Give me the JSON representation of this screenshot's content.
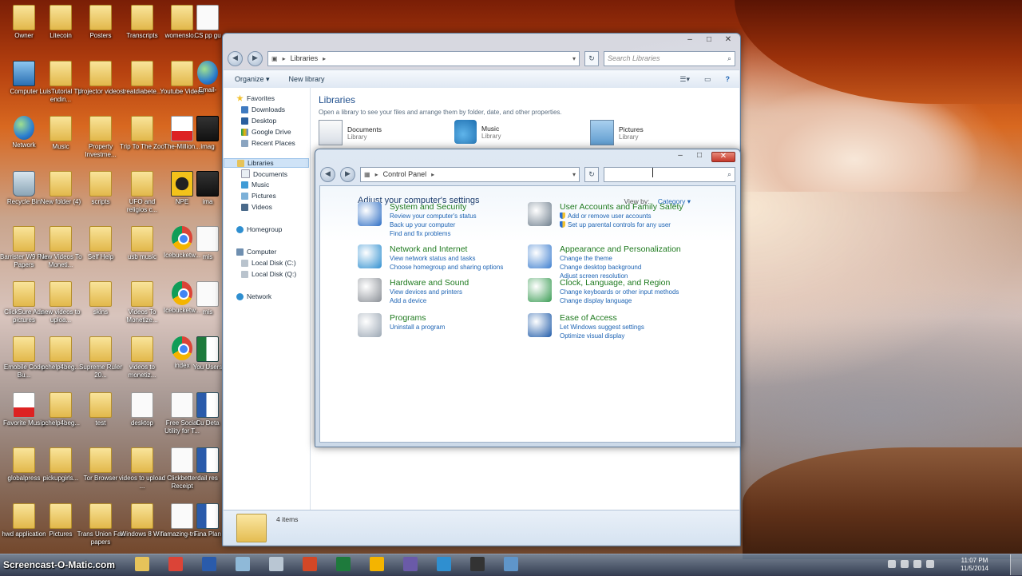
{
  "desktop": {
    "icons": [
      {
        "label": "Owner",
        "type": "folder"
      },
      {
        "label": "Litecoin",
        "type": "folder"
      },
      {
        "label": "Posters",
        "type": "folder"
      },
      {
        "label": "Transcripts",
        "type": "folder"
      },
      {
        "label": "womenslo...",
        "type": "folder"
      },
      {
        "label": "CS pp gu",
        "type": "doc"
      },
      {
        "label": "Computer",
        "type": "pc"
      },
      {
        "label": "LuisTutorial TV endin...",
        "type": "folder"
      },
      {
        "label": "projector videos",
        "type": "folder"
      },
      {
        "label": "treatdiabete...",
        "type": "folder"
      },
      {
        "label": "Youtube Videos",
        "type": "folder"
      },
      {
        "label": "Email-",
        "type": "globe"
      },
      {
        "label": "Network",
        "type": "globe"
      },
      {
        "label": "Music",
        "type": "folder"
      },
      {
        "label": "Property Investme...",
        "type": "folder"
      },
      {
        "label": "Trip To The Zoo",
        "type": "folder"
      },
      {
        "label": "The-Million...",
        "type": "pdf"
      },
      {
        "label": "imag",
        "type": "dark"
      },
      {
        "label": "Recycle Bin",
        "type": "bin"
      },
      {
        "label": "New folder (4)",
        "type": "folder"
      },
      {
        "label": "scripts",
        "type": "folder"
      },
      {
        "label": "UFO and religios c...",
        "type": "folder"
      },
      {
        "label": "NPE",
        "type": "npe"
      },
      {
        "label": "ima",
        "type": "dark"
      },
      {
        "label": "Barrister W9 Fax Papers",
        "type": "folder"
      },
      {
        "label": "New Videos To Moneti...",
        "type": "folder"
      },
      {
        "label": "Self Help",
        "type": "folder"
      },
      {
        "label": "usb music",
        "type": "folder"
      },
      {
        "label": "Icebucketw...",
        "type": "chrome"
      },
      {
        "label": "mis",
        "type": "doc"
      },
      {
        "label": "ClickSure Ads pictures",
        "type": "folder"
      },
      {
        "label": "new videos to uploa...",
        "type": "folder"
      },
      {
        "label": "skins",
        "type": "folder"
      },
      {
        "label": "Videos To Monetize...",
        "type": "folder"
      },
      {
        "label": "Icebucketw...",
        "type": "chrome"
      },
      {
        "label": "mis",
        "type": "doc"
      },
      {
        "label": "Emobile Code Bu...",
        "type": "folder"
      },
      {
        "label": "pchelp4beg...",
        "type": "folder"
      },
      {
        "label": "Supreme Ruler 20...",
        "type": "folder"
      },
      {
        "label": "videos to monetiz...",
        "type": "folder"
      },
      {
        "label": "index",
        "type": "chrome"
      },
      {
        "label": "You Users",
        "type": "excel"
      },
      {
        "label": "Favorite Music",
        "type": "pdf"
      },
      {
        "label": "pchelp4beg...",
        "type": "folder"
      },
      {
        "label": "test",
        "type": "folder"
      },
      {
        "label": "desktop",
        "type": "doc"
      },
      {
        "label": "Free Social Utility for T...",
        "type": "doc"
      },
      {
        "label": "Cu Deta",
        "type": "word"
      },
      {
        "label": "globalpress",
        "type": "folder"
      },
      {
        "label": "pickupgirls...",
        "type": "folder"
      },
      {
        "label": "Tor Browser",
        "type": "folder"
      },
      {
        "label": "videos to upload ...",
        "type": "folder"
      },
      {
        "label": "Clickbetter Receipt",
        "type": "doc"
      },
      {
        "label": "dail res",
        "type": "word"
      },
      {
        "label": "hwd application",
        "type": "folder"
      },
      {
        "label": "Pictures",
        "type": "folder"
      },
      {
        "label": "Trans Union Fax papers",
        "type": "folder"
      },
      {
        "label": "Windows 8 Wifi",
        "type": "folder"
      },
      {
        "label": "amazing-tri...",
        "type": "doc"
      },
      {
        "label": "Fina Plan",
        "type": "word"
      }
    ]
  },
  "libraries_window": {
    "breadcrumb": "Libraries",
    "search_placeholder": "Search Libraries",
    "organize": "Organize ▾",
    "new_library": "New library",
    "title": "Libraries",
    "subtitle": "Open a library to see your files and arrange them by folder, date, and other properties.",
    "nav": {
      "favorites": "Favorites",
      "downloads": "Downloads",
      "desktop": "Desktop",
      "google_drive": "Google Drive",
      "recent_places": "Recent Places",
      "libraries": "Libraries",
      "documents": "Documents",
      "music": "Music",
      "pictures": "Pictures",
      "videos": "Videos",
      "homegroup": "Homegroup",
      "computer": "Computer",
      "local_c": "Local Disk (C:)",
      "local_q": "Local Disk (Q:)",
      "network": "Network"
    },
    "libs": [
      {
        "name": "Documents",
        "type": "Library"
      },
      {
        "name": "Music",
        "type": "Library"
      },
      {
        "name": "Pictures",
        "type": "Library"
      }
    ],
    "item_count": "4 items"
  },
  "control_panel": {
    "breadcrumb": "Control Panel",
    "search_value": "",
    "heading": "Adjust your computer's settings",
    "view_by_label": "View by:",
    "view_by_value": "Category ▾",
    "categories_left": [
      {
        "title": "System and Security",
        "links": [
          "Review your computer's status",
          "Back up your computer",
          "Find and fix problems"
        ],
        "icon": "shield-icon",
        "color": "#2b6cc4"
      },
      {
        "title": "Network and Internet",
        "links": [
          "View network status and tasks",
          "Choose homegroup and sharing options"
        ],
        "icon": "network-globe-icon",
        "color": "#2f8fd0"
      },
      {
        "title": "Hardware and Sound",
        "links": [
          "View devices and printers",
          "Add a device"
        ],
        "icon": "printer-icon",
        "color": "#8a8f96"
      },
      {
        "title": "Programs",
        "links": [
          "Uninstall a program"
        ],
        "icon": "programs-icon",
        "color": "#9aa6b3"
      }
    ],
    "categories_right": [
      {
        "title": "User Accounts and Family Safety",
        "links": [
          "Add or remove user accounts",
          "Set up parental controls for any user"
        ],
        "icon": "users-icon",
        "color": "#6f7f8e"
      },
      {
        "title": "Appearance and Personalization",
        "links": [
          "Change the theme",
          "Change desktop background",
          "Adjust screen resolution"
        ],
        "icon": "monitor-icon",
        "color": "#3d7ecf"
      },
      {
        "title": "Clock, Language, and Region",
        "links": [
          "Change keyboards or other input methods",
          "Change display language"
        ],
        "icon": "globe-clock-icon",
        "color": "#3a9c54"
      },
      {
        "title": "Ease of Access",
        "links": [
          "Let Windows suggest settings",
          "Optimize visual display"
        ],
        "icon": "ease-access-icon",
        "color": "#1e5aa8"
      }
    ]
  },
  "taskbar": {
    "watermark": "Screencast-O-Matic.com",
    "time": "11:07 PM",
    "date": "11/5/2014",
    "items": [
      {
        "name": "explorer",
        "color": "#e6c35a"
      },
      {
        "name": "chrome",
        "color": "#db4437"
      },
      {
        "name": "word",
        "color": "#2a5bab"
      },
      {
        "name": "notepad",
        "color": "#8fb9d8"
      },
      {
        "name": "calculator",
        "color": "#b9c6d3"
      },
      {
        "name": "powerpoint",
        "color": "#d24726"
      },
      {
        "name": "excel",
        "color": "#1e7a3c"
      },
      {
        "name": "chrome2",
        "color": "#f4b400"
      },
      {
        "name": "app",
        "color": "#6a5aa8"
      },
      {
        "name": "app2",
        "color": "#2f8fd0"
      },
      {
        "name": "app3",
        "color": "#333333"
      },
      {
        "name": "control-panel",
        "color": "#5f95c9"
      }
    ]
  }
}
